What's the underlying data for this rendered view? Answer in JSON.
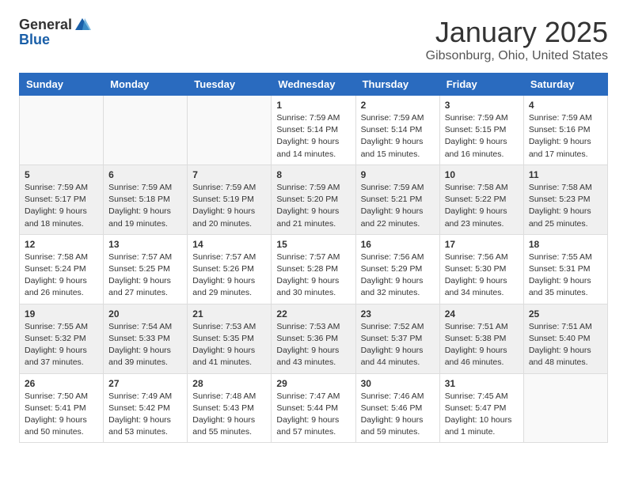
{
  "header": {
    "logo_general": "General",
    "logo_blue": "Blue",
    "month": "January 2025",
    "location": "Gibsonburg, Ohio, United States"
  },
  "weekdays": [
    "Sunday",
    "Monday",
    "Tuesday",
    "Wednesday",
    "Thursday",
    "Friday",
    "Saturday"
  ],
  "weeks": [
    [
      {
        "day": "",
        "info": ""
      },
      {
        "day": "",
        "info": ""
      },
      {
        "day": "",
        "info": ""
      },
      {
        "day": "1",
        "info": "Sunrise: 7:59 AM\nSunset: 5:14 PM\nDaylight: 9 hours\nand 14 minutes."
      },
      {
        "day": "2",
        "info": "Sunrise: 7:59 AM\nSunset: 5:14 PM\nDaylight: 9 hours\nand 15 minutes."
      },
      {
        "day": "3",
        "info": "Sunrise: 7:59 AM\nSunset: 5:15 PM\nDaylight: 9 hours\nand 16 minutes."
      },
      {
        "day": "4",
        "info": "Sunrise: 7:59 AM\nSunset: 5:16 PM\nDaylight: 9 hours\nand 17 minutes."
      }
    ],
    [
      {
        "day": "5",
        "info": "Sunrise: 7:59 AM\nSunset: 5:17 PM\nDaylight: 9 hours\nand 18 minutes."
      },
      {
        "day": "6",
        "info": "Sunrise: 7:59 AM\nSunset: 5:18 PM\nDaylight: 9 hours\nand 19 minutes."
      },
      {
        "day": "7",
        "info": "Sunrise: 7:59 AM\nSunset: 5:19 PM\nDaylight: 9 hours\nand 20 minutes."
      },
      {
        "day": "8",
        "info": "Sunrise: 7:59 AM\nSunset: 5:20 PM\nDaylight: 9 hours\nand 21 minutes."
      },
      {
        "day": "9",
        "info": "Sunrise: 7:59 AM\nSunset: 5:21 PM\nDaylight: 9 hours\nand 22 minutes."
      },
      {
        "day": "10",
        "info": "Sunrise: 7:58 AM\nSunset: 5:22 PM\nDaylight: 9 hours\nand 23 minutes."
      },
      {
        "day": "11",
        "info": "Sunrise: 7:58 AM\nSunset: 5:23 PM\nDaylight: 9 hours\nand 25 minutes."
      }
    ],
    [
      {
        "day": "12",
        "info": "Sunrise: 7:58 AM\nSunset: 5:24 PM\nDaylight: 9 hours\nand 26 minutes."
      },
      {
        "day": "13",
        "info": "Sunrise: 7:57 AM\nSunset: 5:25 PM\nDaylight: 9 hours\nand 27 minutes."
      },
      {
        "day": "14",
        "info": "Sunrise: 7:57 AM\nSunset: 5:26 PM\nDaylight: 9 hours\nand 29 minutes."
      },
      {
        "day": "15",
        "info": "Sunrise: 7:57 AM\nSunset: 5:28 PM\nDaylight: 9 hours\nand 30 minutes."
      },
      {
        "day": "16",
        "info": "Sunrise: 7:56 AM\nSunset: 5:29 PM\nDaylight: 9 hours\nand 32 minutes."
      },
      {
        "day": "17",
        "info": "Sunrise: 7:56 AM\nSunset: 5:30 PM\nDaylight: 9 hours\nand 34 minutes."
      },
      {
        "day": "18",
        "info": "Sunrise: 7:55 AM\nSunset: 5:31 PM\nDaylight: 9 hours\nand 35 minutes."
      }
    ],
    [
      {
        "day": "19",
        "info": "Sunrise: 7:55 AM\nSunset: 5:32 PM\nDaylight: 9 hours\nand 37 minutes."
      },
      {
        "day": "20",
        "info": "Sunrise: 7:54 AM\nSunset: 5:33 PM\nDaylight: 9 hours\nand 39 minutes."
      },
      {
        "day": "21",
        "info": "Sunrise: 7:53 AM\nSunset: 5:35 PM\nDaylight: 9 hours\nand 41 minutes."
      },
      {
        "day": "22",
        "info": "Sunrise: 7:53 AM\nSunset: 5:36 PM\nDaylight: 9 hours\nand 43 minutes."
      },
      {
        "day": "23",
        "info": "Sunrise: 7:52 AM\nSunset: 5:37 PM\nDaylight: 9 hours\nand 44 minutes."
      },
      {
        "day": "24",
        "info": "Sunrise: 7:51 AM\nSunset: 5:38 PM\nDaylight: 9 hours\nand 46 minutes."
      },
      {
        "day": "25",
        "info": "Sunrise: 7:51 AM\nSunset: 5:40 PM\nDaylight: 9 hours\nand 48 minutes."
      }
    ],
    [
      {
        "day": "26",
        "info": "Sunrise: 7:50 AM\nSunset: 5:41 PM\nDaylight: 9 hours\nand 50 minutes."
      },
      {
        "day": "27",
        "info": "Sunrise: 7:49 AM\nSunset: 5:42 PM\nDaylight: 9 hours\nand 53 minutes."
      },
      {
        "day": "28",
        "info": "Sunrise: 7:48 AM\nSunset: 5:43 PM\nDaylight: 9 hours\nand 55 minutes."
      },
      {
        "day": "29",
        "info": "Sunrise: 7:47 AM\nSunset: 5:44 PM\nDaylight: 9 hours\nand 57 minutes."
      },
      {
        "day": "30",
        "info": "Sunrise: 7:46 AM\nSunset: 5:46 PM\nDaylight: 9 hours\nand 59 minutes."
      },
      {
        "day": "31",
        "info": "Sunrise: 7:45 AM\nSunset: 5:47 PM\nDaylight: 10 hours\nand 1 minute."
      },
      {
        "day": "",
        "info": ""
      }
    ]
  ]
}
